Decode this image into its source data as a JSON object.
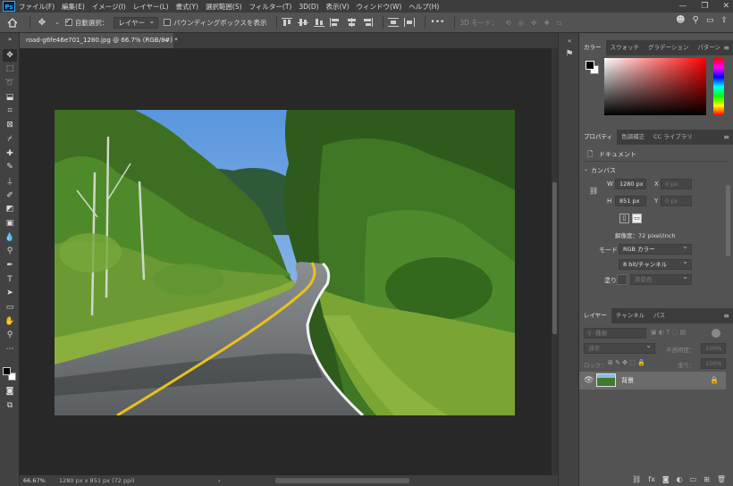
{
  "menubar": {
    "logo": "Ps",
    "items": [
      "ファイル(F)",
      "編集(E)",
      "イメージ(I)",
      "レイヤー(L)",
      "書式(Y)",
      "選択範囲(S)",
      "フィルター(T)",
      "3D(D)",
      "表示(V)",
      "ウィンドウ(W)",
      "ヘルプ(H)"
    ],
    "window_controls": [
      "—",
      "❐",
      "✕"
    ]
  },
  "options": {
    "auto_select_label": "自動選択：",
    "auto_select_checked": true,
    "auto_select_value": "レイヤー",
    "bounding_box_label": "バウンディングボックスを表示",
    "bounding_box_checked": false,
    "more": "•••",
    "mode_3d_label": "3D モード："
  },
  "document": {
    "tab_title": "road-g6fe46e701_1280.jpg @ 66.7% (RGB/8#) *",
    "close": "×",
    "zoom": "66.67%",
    "info": "1280 px x 851 px (72 ppi)"
  },
  "color_panel": {
    "tabs": [
      "カラー",
      "スウォッチ",
      "グラデーション",
      "パターン"
    ],
    "active_tab": 0,
    "foreground": "#000000",
    "background": "#ffffff"
  },
  "properties_panel": {
    "tabs": [
      "プロパティ",
      "色調補正",
      "CC ライブラリ"
    ],
    "active_tab": 0,
    "doc_label": "ドキュメント",
    "canvas_label": "カンバス",
    "width_label": "W",
    "width_value": "1280 px",
    "height_label": "H",
    "height_value": "851 px",
    "x_label": "X",
    "y_label": "Y",
    "x_placeholder": "0 px",
    "y_placeholder": "0 px",
    "resolution": "解像度：72 pixel/inch",
    "mode_label": "モード",
    "mode_value": "RGB カラー",
    "depth_value": "8 bit/チャンネル",
    "fill_label": "塗り",
    "fill_value": "背景色"
  },
  "layers_panel": {
    "tabs": [
      "レイヤー",
      "チャンネル",
      "パス"
    ],
    "active_tab": 0,
    "kind_placeholder": "種類",
    "blend_mode": "通常",
    "opacity_label": "不透明度：",
    "opacity_value": "100%",
    "lock_label": "ロック：",
    "fill_label": "塗り：",
    "fill_value": "100%",
    "layers": [
      {
        "name": "背景",
        "visible": true,
        "locked": true
      }
    ]
  }
}
